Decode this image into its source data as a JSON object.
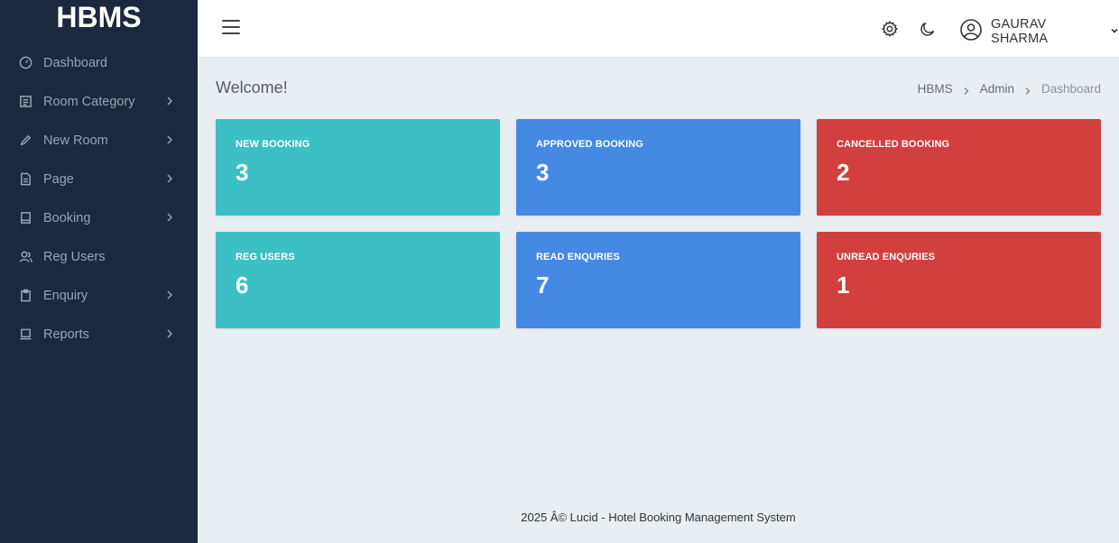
{
  "app": {
    "brand": "HBMS"
  },
  "sidebar": {
    "items": [
      {
        "label": "Dashboard",
        "icon": "dashboard-icon",
        "has_chevron": false
      },
      {
        "label": "Room Category",
        "icon": "category-icon",
        "has_chevron": true
      },
      {
        "label": "New Room",
        "icon": "pencil-icon",
        "has_chevron": true
      },
      {
        "label": "Page",
        "icon": "page-icon",
        "has_chevron": true
      },
      {
        "label": "Booking",
        "icon": "book-icon",
        "has_chevron": true
      },
      {
        "label": "Reg Users",
        "icon": "users-icon",
        "has_chevron": false
      },
      {
        "label": "Enquiry",
        "icon": "clipboard-icon",
        "has_chevron": true
      },
      {
        "label": "Reports",
        "icon": "laptop-icon",
        "has_chevron": true
      }
    ]
  },
  "header": {
    "user_name": "GAURAV SHARMA",
    "icons": [
      "menu-icon",
      "settings-icon",
      "moon-icon",
      "user-circle-icon",
      "chevron-down-icon"
    ]
  },
  "main": {
    "welcome": "Welcome!",
    "breadcrumb": [
      "HBMS",
      "Admin",
      "Dashboard"
    ],
    "cards": [
      {
        "label": "NEW BOOKING",
        "value": "3",
        "color": "#3cc0c4"
      },
      {
        "label": "APPROVED BOOKING",
        "value": "3",
        "color": "#4589e2"
      },
      {
        "label": "CANCELLED BOOKING",
        "value": "2",
        "color": "#d23f3f"
      },
      {
        "label": "REG USERS",
        "value": "6",
        "color": "#3cc0c4"
      },
      {
        "label": "READ ENQURIES",
        "value": "7",
        "color": "#4589e2"
      },
      {
        "label": "UNREAD ENQURIES",
        "value": "1",
        "color": "#d23f3f"
      }
    ]
  },
  "footer": {
    "text": "2025 Â© Lucid - Hotel Booking Management System"
  },
  "colors": {
    "sidebar_bg": "#1b2840",
    "page_bg": "#e8eef2",
    "teal": "#3cc0c4",
    "blue": "#4589e2",
    "red": "#d23f3f"
  }
}
